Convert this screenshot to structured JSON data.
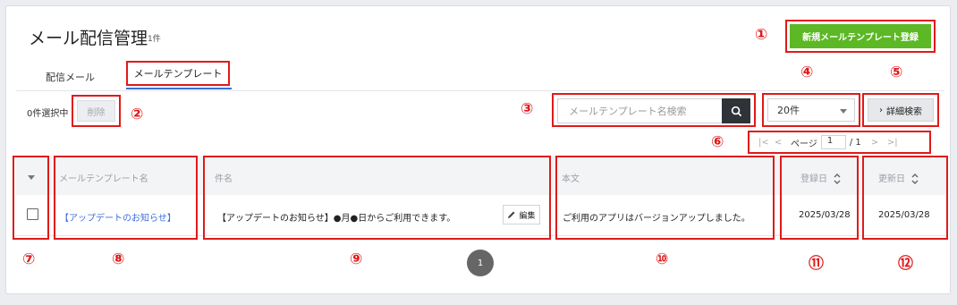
{
  "page": {
    "title": "メール配信管理",
    "count": "1件"
  },
  "tabs": [
    {
      "label": "配信メール"
    },
    {
      "label": "メールテンプレート"
    }
  ],
  "toolbar": {
    "new_button": "新規メールテンプレート登録",
    "selected_text": "0件選択中",
    "delete_button": "削除",
    "search_placeholder": "メールテンプレート名検索",
    "per_page": "20件",
    "advanced_search": "詳細検索"
  },
  "pagination": {
    "label": "ページ",
    "current": "1",
    "total": "/ 1",
    "page_button": "1"
  },
  "table": {
    "headers": {
      "name": "メールテンプレート名",
      "subject": "件名",
      "body": "本文",
      "registered": "登録日",
      "updated": "更新日"
    },
    "rows": [
      {
        "name": "【アップデートのお知らせ】",
        "subject": "【アップデートのお知らせ】●月●日からご利用できます。",
        "edit": "編集",
        "body": "ご利用のアプリはバージョンアップしました。",
        "registered": "2025/03/28",
        "updated": "2025/03/28"
      }
    ]
  },
  "annotations": [
    "①",
    "②",
    "③",
    "④",
    "⑤",
    "⑥",
    "⑦",
    "⑧",
    "⑨",
    "⑩",
    "⑪",
    "⑫"
  ],
  "colors": {
    "accent_green": "#5cb825",
    "annotation_red": "#e01a1a",
    "link_blue": "#3c6fd7"
  }
}
